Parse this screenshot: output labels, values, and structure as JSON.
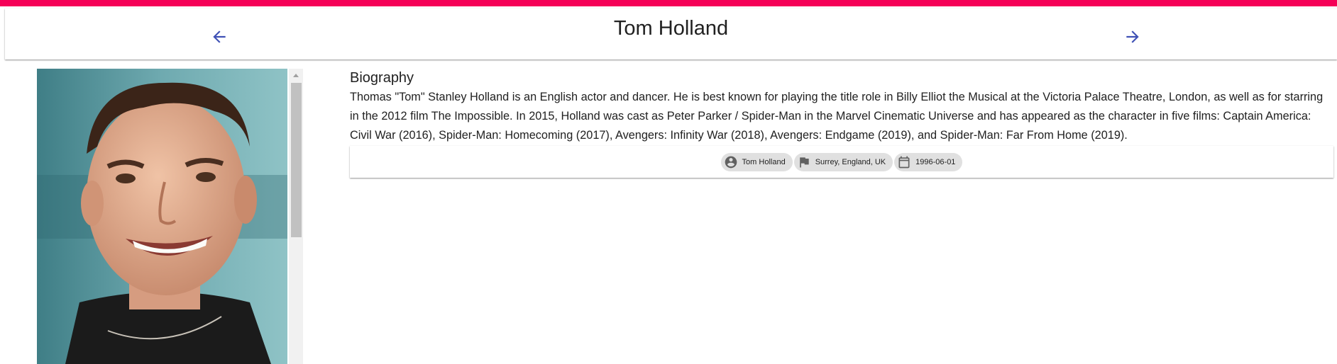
{
  "header": {
    "title": "Tom Holland",
    "prev_icon": "arrow-left-icon",
    "next_icon": "arrow-right-icon"
  },
  "photo": {
    "alt": "Tom Holland"
  },
  "biography": {
    "heading": "Biography",
    "text": "Thomas \"Tom\" Stanley Holland is an English actor and dancer. He is best known for playing the title role in Billy Elliot the Musical at the Victoria Palace Theatre, London, as well as for starring in the 2012 film The Impossible. In 2015, Holland was cast as Peter Parker / Spider-Man in the Marvel Cinematic Universe and has appeared as the character in five films: Captain America: Civil War (2016), Spider-Man: Homecoming (2017), Avengers: Infinity War (2018), Avengers: Endgame (2019), and Spider-Man: Far From Home (2019)."
  },
  "chips": {
    "name": {
      "icon": "account-circle-icon",
      "label": "Tom Holland"
    },
    "place": {
      "icon": "flag-icon",
      "label": "Surrey, England, UK"
    },
    "birthday": {
      "icon": "calendar-icon",
      "label": "1996-06-01"
    }
  },
  "colors": {
    "accent": "#f50057",
    "nav_icon": "#3f51b5",
    "chip_bg": "#e0e0e0"
  }
}
